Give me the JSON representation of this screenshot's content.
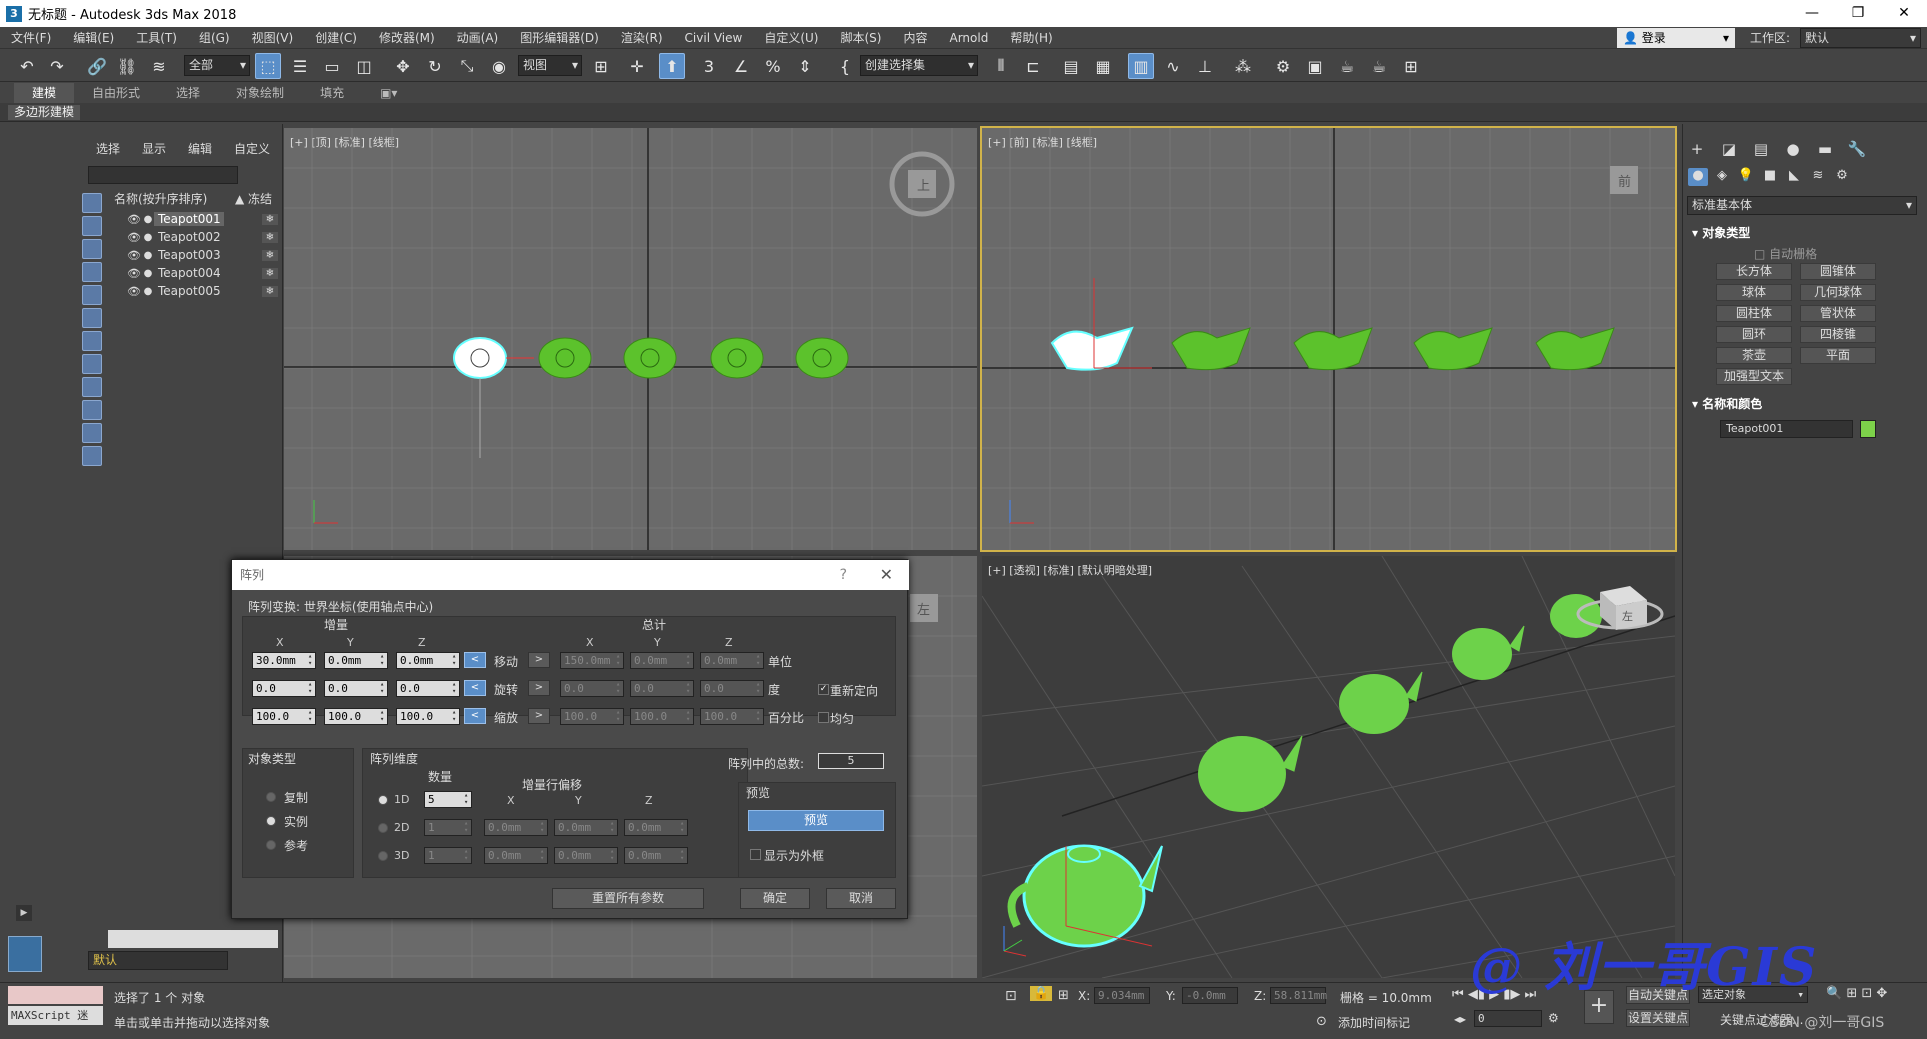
{
  "window": {
    "title": "无标题 - Autodesk 3ds Max 2018"
  },
  "menu": [
    "文件(F)",
    "编辑(E)",
    "工具(T)",
    "组(G)",
    "视图(V)",
    "创建(C)",
    "修改器(M)",
    "动画(A)",
    "图形编辑器(D)",
    "渲染(R)",
    "Civil View",
    "自定义(U)",
    "脚本(S)",
    "内容",
    "Arnold",
    "帮助(H)"
  ],
  "account": {
    "login": "登录",
    "workspace_label": "工作区:",
    "workspace_value": "默认"
  },
  "toolbar": {
    "filter_select": "全部",
    "coord_select": "视图",
    "named_sel_set": "创建选择集"
  },
  "ribbon": {
    "tabs": [
      "建模",
      "自由形式",
      "选择",
      "对象绘制",
      "填充"
    ],
    "active": "建模",
    "sub": "多边形建模"
  },
  "scene_explorer": {
    "tabs": [
      "选择",
      "显示",
      "编辑",
      "自定义"
    ],
    "col_name": "名称(按升序排序)",
    "col_freeze": "冻结",
    "items": [
      "Teapot001",
      "Teapot002",
      "Teapot003",
      "Teapot004",
      "Teapot005"
    ],
    "layer": "默认"
  },
  "viewports": {
    "top": "[+] [顶] [标准] [线框]",
    "front": "[+] [前] [标准] [线框]",
    "persp": "[+] [透视] [标准] [默认明暗处理]",
    "cube_top": "上",
    "cube_front": "前",
    "cube_left": "左",
    "cube_persp": "左"
  },
  "command_panel": {
    "category": "标准基本体",
    "obj_type_header": "对象类型",
    "autogrid": "自动栅格",
    "buttons": [
      "长方体",
      "圆锥体",
      "球体",
      "几何球体",
      "圆柱体",
      "管状体",
      "圆环",
      "四棱锥",
      "茶壶",
      "平面",
      "加强型文本"
    ],
    "name_color_header": "名称和颜色",
    "object_name": "Teapot001",
    "object_color": "#7dd24a"
  },
  "dialog": {
    "title": "阵列",
    "help": "?",
    "transform_header": "阵列变换: 世界坐标(使用轴点中心)",
    "incremental": "增量",
    "totals": "总计",
    "axes": [
      "X",
      "Y",
      "Z"
    ],
    "rows": [
      {
        "label": "移动",
        "inc": [
          "30.0mm",
          "0.0mm",
          "0.0mm"
        ],
        "tot": [
          "150.0mm",
          "0.0mm",
          "0.0mm"
        ],
        "unit": "单位"
      },
      {
        "label": "旋转",
        "inc": [
          "0.0",
          "0.0",
          "0.0"
        ],
        "tot": [
          "0.0",
          "0.0",
          "0.0"
        ],
        "unit": "度"
      },
      {
        "label": "缩放",
        "inc": [
          "100.0",
          "100.0",
          "100.0"
        ],
        "tot": [
          "100.0",
          "100.0",
          "100.0"
        ],
        "unit": "百分比"
      }
    ],
    "reorient": "重新定向",
    "uniform": "均匀",
    "object_type": {
      "header": "对象类型",
      "options": [
        "复制",
        "实例",
        "参考"
      ],
      "selected": "实例"
    },
    "dimensions": {
      "header": "阵列维度",
      "count": "数量",
      "offset": "增量行偏移",
      "rows": [
        {
          "dim": "1D",
          "count": "5",
          "offsets": [],
          "selected": true
        },
        {
          "dim": "2D",
          "count": "1",
          "offsets": [
            "0.0mm",
            "0.0mm",
            "0.0mm"
          ],
          "selected": false
        },
        {
          "dim": "3D",
          "count": "1",
          "offsets": [
            "0.0mm",
            "0.0mm",
            "0.0mm"
          ],
          "selected": false
        }
      ]
    },
    "total_label": "阵列中的总数:",
    "total_value": "5",
    "preview_header": "预览",
    "preview_button": "预览",
    "show_as_box": "显示为外框",
    "reset": "重置所有参数",
    "ok": "确定",
    "cancel": "取消"
  },
  "status": {
    "selected": "选择了 1 个 对象",
    "hint": "单击或单击并拖动以选择对象",
    "maxscript": "MAXScript 迷",
    "x_label": "X:",
    "x_value": "9.034mm",
    "y_label": "Y:",
    "y_value": "-0.0mm",
    "z_label": "Z:",
    "z_value": "58.811mm",
    "grid": "栅格 = 10.0mm",
    "add_time_tag": "添加时间标记",
    "auto_key": "自动关键点",
    "set_key": "设置关键点",
    "sel_object": "选定对象",
    "key_filter": "关键点过滤器...",
    "frame": "0"
  },
  "watermark": "@ 刘一哥GIS",
  "csdn": "CSDN @刘一哥GIS"
}
